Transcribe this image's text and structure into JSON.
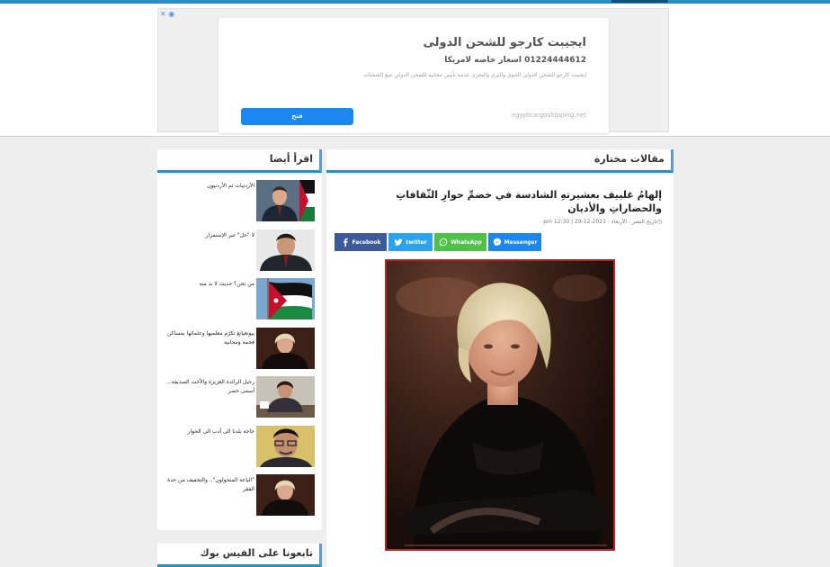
{
  "ad": {
    "badge": "✕ ◉",
    "title": "ايجيبت كارجو للشحن الدولى",
    "subtitle": "01224444612 اسعار خاصه لامريكا",
    "description": "ايجيبت كارجو للشحن الدولى الجوى والبرى والبحرى خدمة تأمين مجانيه للشحن الدولي تتبع الشحنات",
    "button_label": "فتح",
    "domain": "egyptcargoshipping.net"
  },
  "featured": {
    "section_title": "مقالات مختارة",
    "article_title": "إلهامُ غلييف بعشيرتهِ الشادسة في خضمِّ حوارِ الثّقافاتِ والحضاراتِ والأديان",
    "meta": "تاريخ النشر : الأربعاء - 2021-12-29 | 12:30 pm",
    "share": {
      "facebook": "Facebook",
      "twitter": "twitter",
      "whatsapp": "WhatsApp",
      "messenger": "Messenger"
    },
    "colors": {
      "facebook": "#3b5a9a",
      "twitter": "#2aa3ef",
      "whatsapp": "#4dc247",
      "messenger": "#1a86f0"
    }
  },
  "related": {
    "section_title": "اقرأ أيضا",
    "items": [
      {
        "title": "الأردنيات ثم الأردنيون",
        "thumb": "man-in-suit-with-jordan-flag"
      },
      {
        "title": "لا \"حل\" غير الإستمرار",
        "thumb": "man-portrait"
      },
      {
        "title": "من نحن؟ حديث لا بد منه",
        "thumb": "jordan-flag"
      },
      {
        "title": "بيونغيانغ تكرّم معلميها وعلمائها بمساكن فخمة ومجانية",
        "thumb": "woman-portrait"
      },
      {
        "title": "رحيل الرائدة العزيزة والأخت الصديقة... أسمى خضر",
        "thumb": "woman-at-desk"
      },
      {
        "title": "حاجة بلدنا الى أدب الى الحوار",
        "thumb": "man-with-glasses"
      },
      {
        "title": "\"الباعة المتجولون\".. والتخفيف من حدة الفقر",
        "thumb": "woman-portrait"
      }
    ]
  },
  "facebook": {
    "section_title": "تابعونا على الفيس بوك"
  }
}
